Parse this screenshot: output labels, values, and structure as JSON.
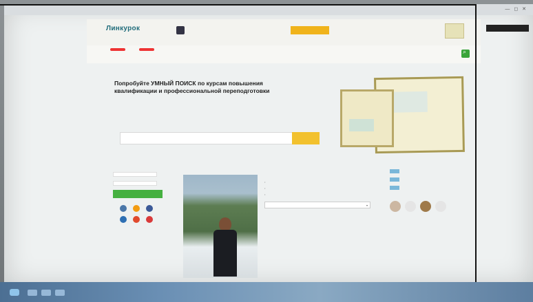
{
  "browser": {
    "tab_labels": [
      "",
      ""
    ],
    "window_controls": "— ◻ ✕"
  },
  "site": {
    "logo": "Линкурок",
    "promo_button": "",
    "promo_text": "",
    "promo_right_text": "",
    "nav": [
      "",
      "",
      "",
      "",
      "",
      "",
      "",
      "",
      ""
    ]
  },
  "hero": {
    "small_label": "",
    "title": "Попробуйте УМНЫЙ ПОИСК по курсам повышения квалификации и профессиональной переподготовки",
    "col1_label": "",
    "col1_value": "",
    "col2_label": "",
    "col2_value": "",
    "search_placeholder": "",
    "search_button": ""
  },
  "content": {
    "tabs": [
      "",
      "",
      ""
    ],
    "sidebar": {
      "inputs": [
        "",
        ""
      ],
      "forgot_link": "",
      "login_button": "",
      "social_label": ""
    },
    "photo_caption": "",
    "wide_button": "",
    "profile": {
      "name": "",
      "rows": [
        "",
        "",
        ""
      ],
      "select_label": "",
      "select_value": "",
      "text": ""
    },
    "right": {
      "head1": "",
      "items": [
        "",
        "",
        ""
      ],
      "more": "",
      "head2": ""
    }
  },
  "taskbar": {
    "tray": ""
  }
}
